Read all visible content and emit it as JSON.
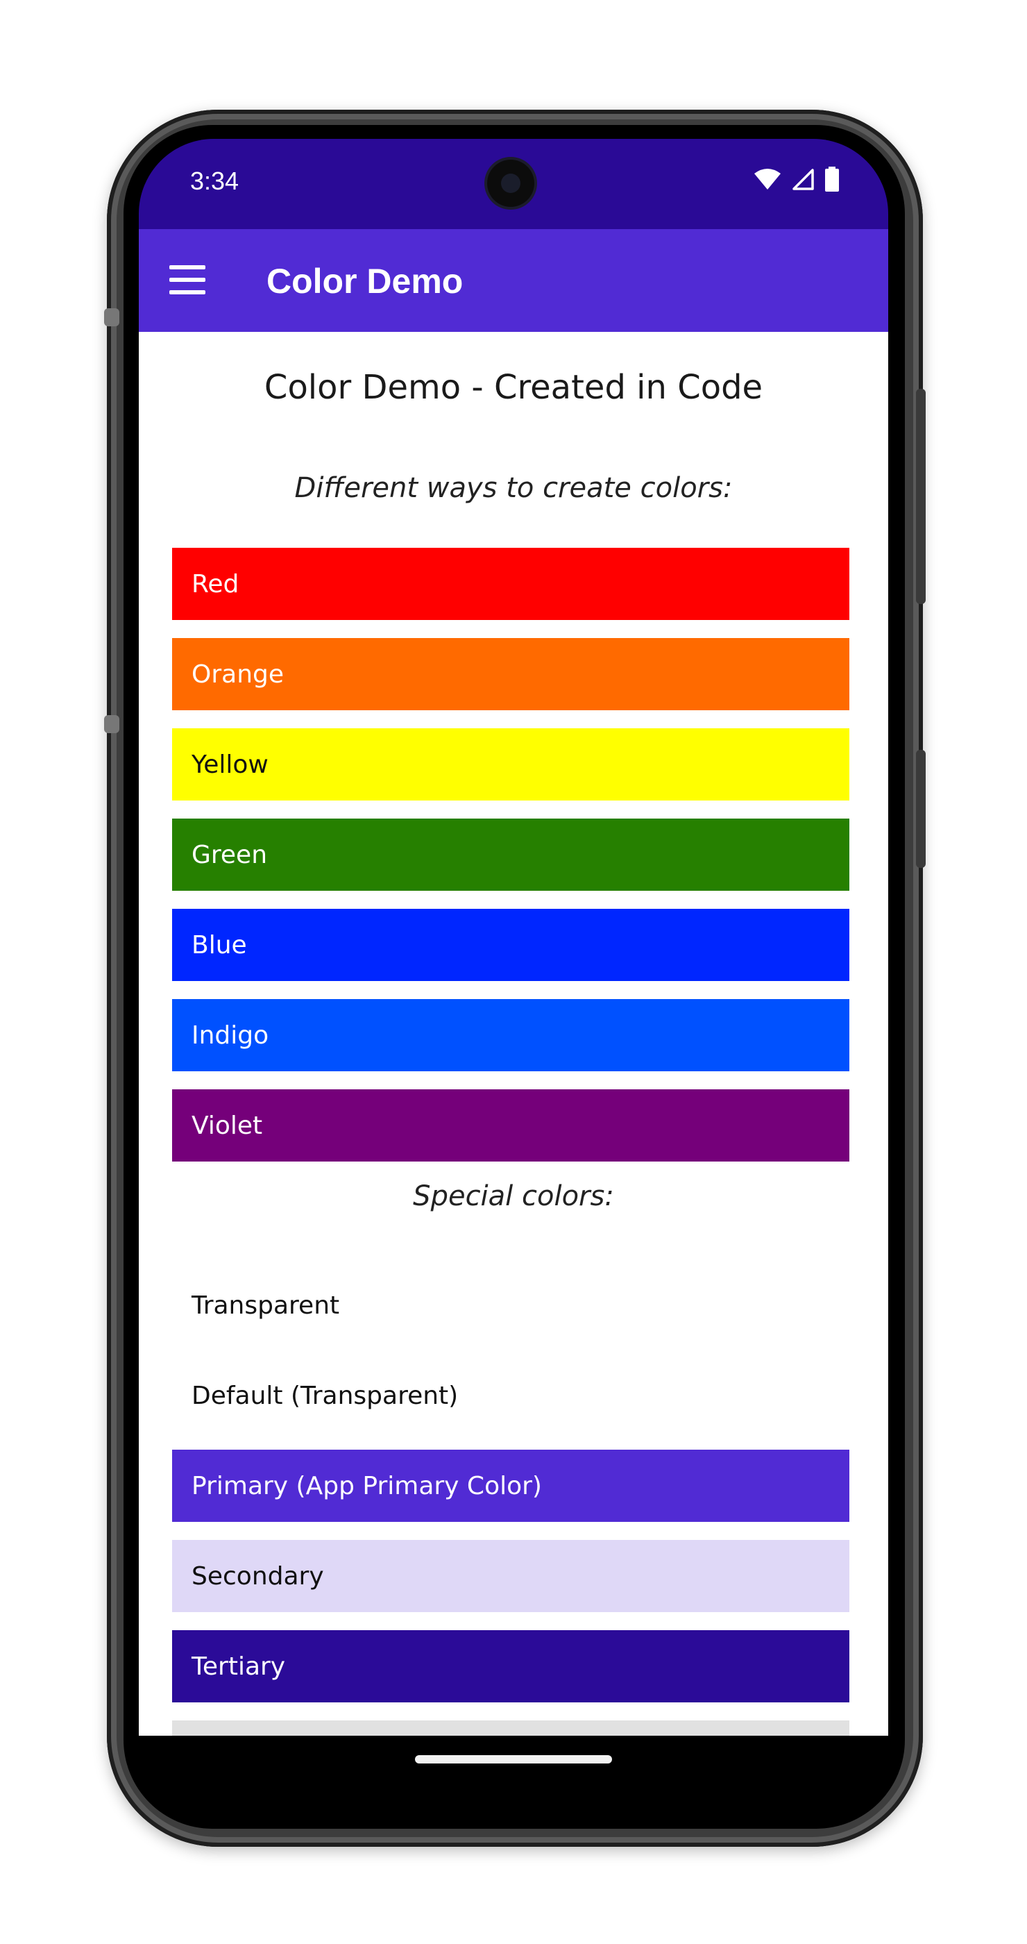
{
  "status_bar": {
    "time": "3:34",
    "icons": [
      "wifi-icon",
      "signal-icon",
      "battery-icon"
    ]
  },
  "app_bar": {
    "title": "Color Demo",
    "menu_icon": "menu-icon"
  },
  "page": {
    "title": "Color Demo - Created in Code",
    "section1_heading": "Different ways to create colors:",
    "section2_heading": "Special colors:"
  },
  "swatches": [
    {
      "label": "Red",
      "bg": "#ff0000",
      "fg": "#ffffff"
    },
    {
      "label": "Orange",
      "bg": "#ff6a00",
      "fg": "#ffffff"
    },
    {
      "label": "Yellow",
      "bg": "#ffff00",
      "fg": "#111111"
    },
    {
      "label": "Green",
      "bg": "#268000",
      "fg": "#ffffff"
    },
    {
      "label": "Blue",
      "bg": "#0026ff",
      "fg": "#ffffff"
    },
    {
      "label": "Indigo",
      "bg": "#0051ff",
      "fg": "#ffffff"
    },
    {
      "label": "Violet",
      "bg": "#75007a",
      "fg": "#ffffff"
    }
  ],
  "special_swatches": [
    {
      "label": "Transparent",
      "bg": "transparent",
      "fg": "#111111"
    },
    {
      "label": "Default (Transparent)",
      "bg": "transparent",
      "fg": "#111111"
    },
    {
      "label": "Primary (App Primary Color)",
      "bg": "#512bd4",
      "fg": "#ffffff"
    },
    {
      "label": "Secondary",
      "bg": "#dfd8f7",
      "fg": "#111111"
    },
    {
      "label": "Tertiary",
      "bg": "#2b0b98",
      "fg": "#ffffff"
    },
    {
      "label": "",
      "bg": "#e1e1e1",
      "fg": "#111111"
    }
  ],
  "colors": {
    "status_bar": "#2a0a96",
    "app_bar": "#512bd4"
  }
}
